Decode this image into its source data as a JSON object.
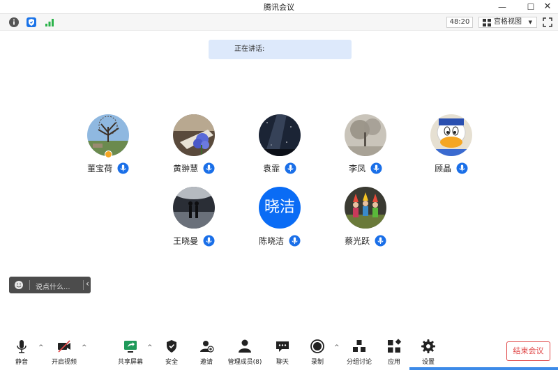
{
  "window": {
    "title": "腾讯会议",
    "controls": {
      "minimize": "—",
      "maximize": "☐",
      "close": "✕"
    }
  },
  "topbar": {
    "icons": [
      "info-icon",
      "shield-icon",
      "signal-icon"
    ],
    "timer": "48:20",
    "view_label": "宫格视图",
    "view_arrow": "▼"
  },
  "speaking": {
    "label": "正在讲话:"
  },
  "participants": [
    {
      "name": "董宝荷",
      "host": true,
      "avatar": "tree-photo"
    },
    {
      "name": "黄翀慧",
      "host": false,
      "avatar": "flower-photo"
    },
    {
      "name": "袁霏",
      "host": false,
      "avatar": "galaxy-photo"
    },
    {
      "name": "李凤",
      "host": false,
      "avatar": "tree-landscape-photo"
    },
    {
      "name": "顾晶",
      "host": false,
      "avatar": "donald-duck-photo"
    },
    {
      "name": "王晓曼",
      "host": false,
      "avatar": "couple-silhouette-photo"
    },
    {
      "name": "陈晓洁",
      "host": false,
      "avatar_text": "晓洁"
    },
    {
      "name": "蔡光跃",
      "host": false,
      "avatar": "kids-photo"
    }
  ],
  "chat": {
    "placeholder": "说点什么...",
    "collapse": "‹"
  },
  "toolbar": {
    "mute": "静音",
    "video": "开启视频",
    "share": "共享屏幕",
    "security": "安全",
    "invite": "邀请",
    "members": "管理成员(8)",
    "chat": "聊天",
    "record": "录制",
    "breakout": "分组讨论",
    "apps": "应用",
    "settings": "设置",
    "caret": "^"
  },
  "end_meeting": "结束会议",
  "colors": {
    "accent": "#0a6cf5",
    "end": "#e04848",
    "speaking_bg": "#dde9fb"
  }
}
